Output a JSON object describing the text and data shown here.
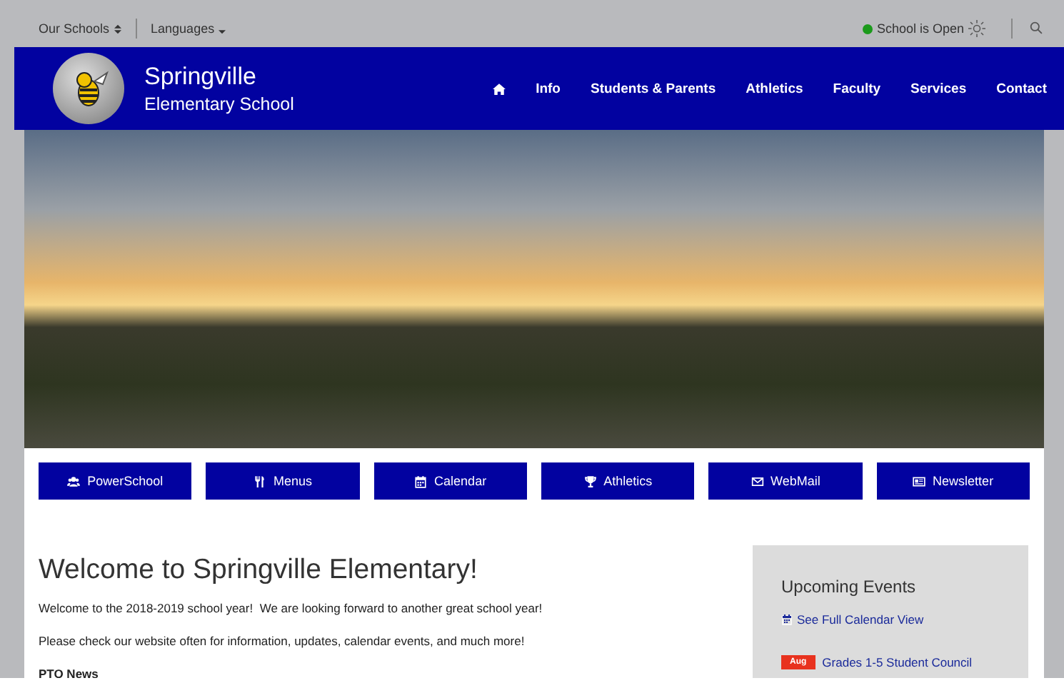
{
  "top_bar": {
    "schools_menu": "Our Schools",
    "languages_menu": "Languages",
    "status": {
      "text": "School is Open",
      "open": true
    }
  },
  "header": {
    "school_name": "Springville",
    "school_subtitle": "Elementary School",
    "nav": [
      {
        "kind": "home"
      },
      {
        "kind": "link",
        "label": "Info"
      },
      {
        "kind": "link",
        "label": "Students & Parents"
      },
      {
        "kind": "link",
        "label": "Athletics"
      },
      {
        "kind": "link",
        "label": "Faculty"
      },
      {
        "kind": "link",
        "label": "Services"
      },
      {
        "kind": "link",
        "label": "Contact"
      }
    ]
  },
  "quick_links": [
    {
      "label": "PowerSchool",
      "kind": "users"
    },
    {
      "label": "Menus",
      "kind": "utensils"
    },
    {
      "label": "Calendar",
      "kind": "calendar"
    },
    {
      "label": "Athletics",
      "kind": "trophy"
    },
    {
      "label": "WebMail",
      "kind": "envelope"
    },
    {
      "label": "Newsletter",
      "kind": "newspaper"
    }
  ],
  "welcome": {
    "title": "Welcome to Springville Elementary!",
    "paragraphs": [
      "Welcome to the 2018-2019 school year!  We are looking forward to another great school year!",
      "Please check our website often for information, updates, calendar events, and much more!"
    ],
    "subheading": "PTO News"
  },
  "events": {
    "title": "Upcoming Events",
    "calendar_link": "See Full Calendar View",
    "items": [
      {
        "month": "Aug",
        "title": "Grades 1-5 Student Council"
      }
    ]
  }
}
